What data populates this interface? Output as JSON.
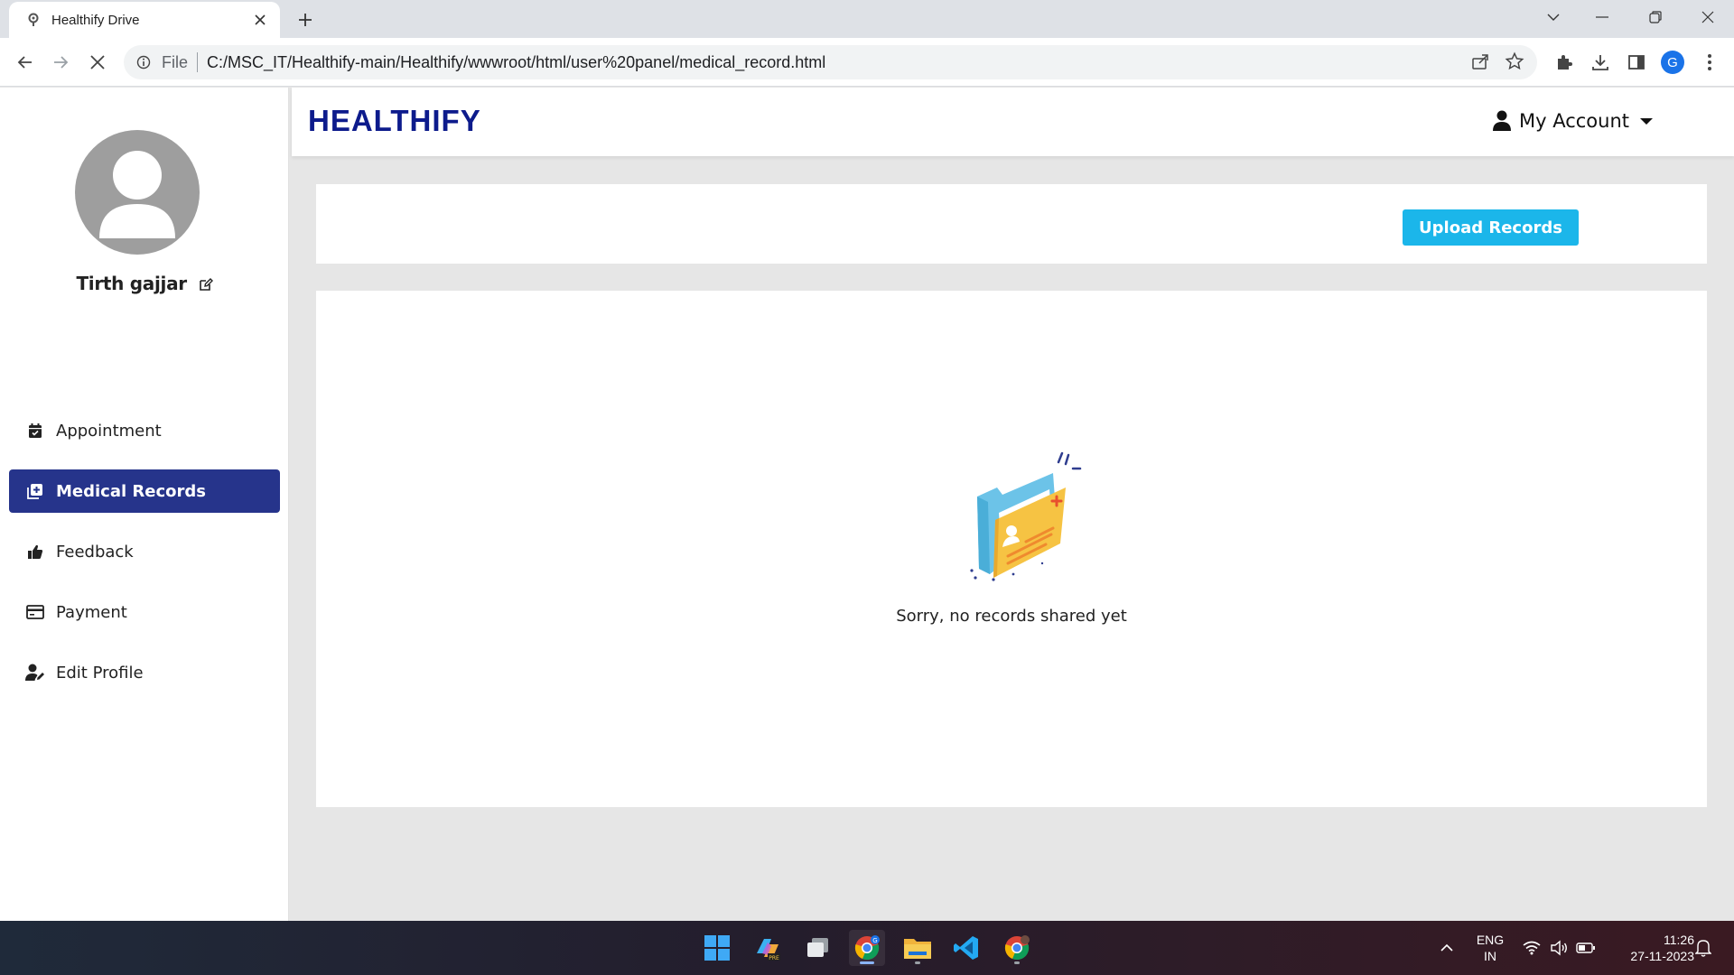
{
  "browser": {
    "tab_title": "Healthify Drive",
    "url_scheme": "File",
    "url": "C:/MSC_IT/Healthify-main/Healthify/wwwroot/html/user%20panel/medical_record.html",
    "profile_initial": "G"
  },
  "sidebar": {
    "user_name": "Tirth gajjar",
    "items": [
      {
        "label": "Appointment",
        "icon": "calendar-check-icon",
        "active": false
      },
      {
        "label": "Medical Records",
        "icon": "medical-record-icon",
        "active": true
      },
      {
        "label": "Feedback",
        "icon": "thumbs-up-icon",
        "active": false
      },
      {
        "label": "Payment",
        "icon": "credit-card-icon",
        "active": false
      },
      {
        "label": "Edit Profile",
        "icon": "user-edit-icon",
        "active": false
      }
    ]
  },
  "header": {
    "brand": "HEALTHIFY",
    "account_label": "My Account"
  },
  "main": {
    "upload_button": "Upload Records",
    "empty_message": "Sorry, no records shared yet"
  },
  "taskbar": {
    "language": "ENG",
    "region": "IN",
    "time": "11:26",
    "date": "27-11-2023"
  },
  "colors": {
    "brand": "#0d1b8c",
    "active_menu": "#26348b",
    "upload_button": "#1bb6ea"
  }
}
